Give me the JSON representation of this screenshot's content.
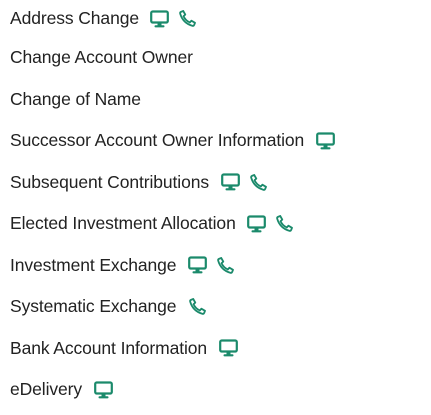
{
  "accent_color": "#1b8a6b",
  "text_color": "#222222",
  "items": [
    {
      "label": "Address Change",
      "icons": [
        "computer-icon",
        "phone-icon"
      ]
    },
    {
      "label": "Change Account Owner",
      "icons": []
    },
    {
      "label": "Change of Name",
      "icons": []
    },
    {
      "label": "Successor Account Owner Information",
      "icons": [
        "computer-icon"
      ]
    },
    {
      "label": "Subsequent Contributions",
      "icons": [
        "computer-icon",
        "phone-icon"
      ]
    },
    {
      "label": "Elected Investment Allocation",
      "icons": [
        "computer-icon",
        "phone-icon"
      ]
    },
    {
      "label": "Investment Exchange",
      "icons": [
        "computer-icon",
        "phone-icon"
      ]
    },
    {
      "label": "Systematic Exchange",
      "icons": [
        "phone-icon"
      ]
    },
    {
      "label": "Bank Account Information",
      "icons": [
        "computer-icon"
      ]
    },
    {
      "label": "eDelivery",
      "icons": [
        "computer-icon"
      ]
    }
  ]
}
